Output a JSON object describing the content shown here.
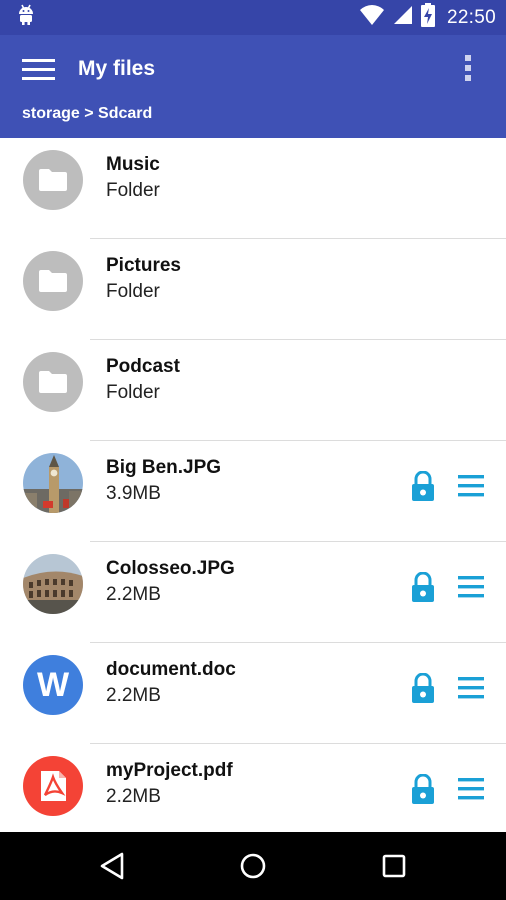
{
  "status_bar": {
    "time": "22:50",
    "icons": [
      "android-icon",
      "wifi-icon",
      "signal-icon",
      "battery-charging-icon"
    ]
  },
  "app_bar": {
    "title": "My files",
    "breadcrumb": "storage > Sdcard",
    "background_color": "#3f51b5",
    "status_color": "#3645a8"
  },
  "files": [
    {
      "name": "Music",
      "meta": "Folder",
      "type": "folder"
    },
    {
      "name": "Pictures",
      "meta": "Folder",
      "type": "folder"
    },
    {
      "name": "Podcast",
      "meta": "Folder",
      "type": "folder"
    },
    {
      "name": "Big Ben.JPG",
      "meta": "3.9MB",
      "type": "image",
      "icon": "big-ben-thumbnail"
    },
    {
      "name": "Colosseo.JPG",
      "meta": "2.2MB",
      "type": "image",
      "icon": "colosseum-thumbnail"
    },
    {
      "name": "document.doc",
      "meta": "2.2MB",
      "type": "doc",
      "icon_letter": "W"
    },
    {
      "name": "myProject.pdf",
      "meta": "2.2MB",
      "type": "pdf"
    }
  ],
  "colors": {
    "accent": "#1aa0d6",
    "folder": "#bdbdbd",
    "word": "#3f7fdd",
    "pdf": "#f44336"
  },
  "nav_bar": {
    "icons": [
      "back-icon",
      "home-icon",
      "recents-icon"
    ]
  }
}
